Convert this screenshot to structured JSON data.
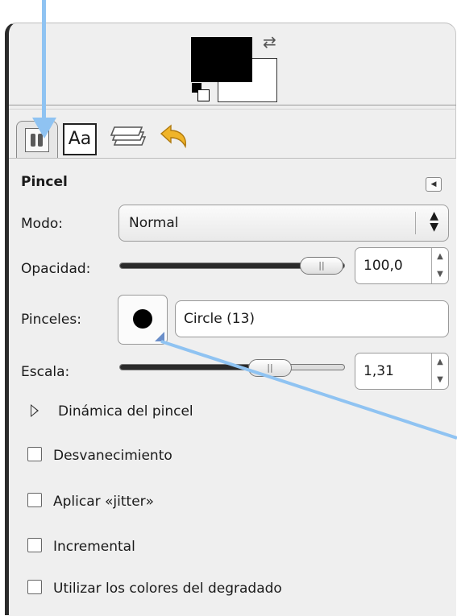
{
  "colors": {
    "foreground": "#000000",
    "background": "#ffffff",
    "annotation": "#8fc3f2",
    "panel": "#efefef"
  },
  "tabs": [
    {
      "name": "tool-options-tab",
      "icon": "paintbrush-icon"
    },
    {
      "name": "fonts-tab",
      "label": "Aa"
    },
    {
      "name": "layers-tab",
      "icon": "layers-icon"
    },
    {
      "name": "undo-history-tab",
      "icon": "undo-icon"
    }
  ],
  "options": {
    "title": "Pincel",
    "mode_label": "Modo:",
    "mode_value": "Normal",
    "opacity_label": "Opacidad:",
    "opacity_value": "100,0",
    "opacity_fraction": 1.0,
    "brushes_label": "Pinceles:",
    "brush_name": "Circle (13)",
    "scale_label": "Escala:",
    "scale_value": "1,31",
    "dynamics_label": "Dinámica del pincel",
    "checkboxes": [
      {
        "label": "Desvanecimiento",
        "checked": false
      },
      {
        "label": "Aplicar «jitter»",
        "checked": false
      },
      {
        "label": "Incremental",
        "checked": false
      },
      {
        "label": "Utilizar los colores del degradado",
        "checked": false
      }
    ]
  }
}
